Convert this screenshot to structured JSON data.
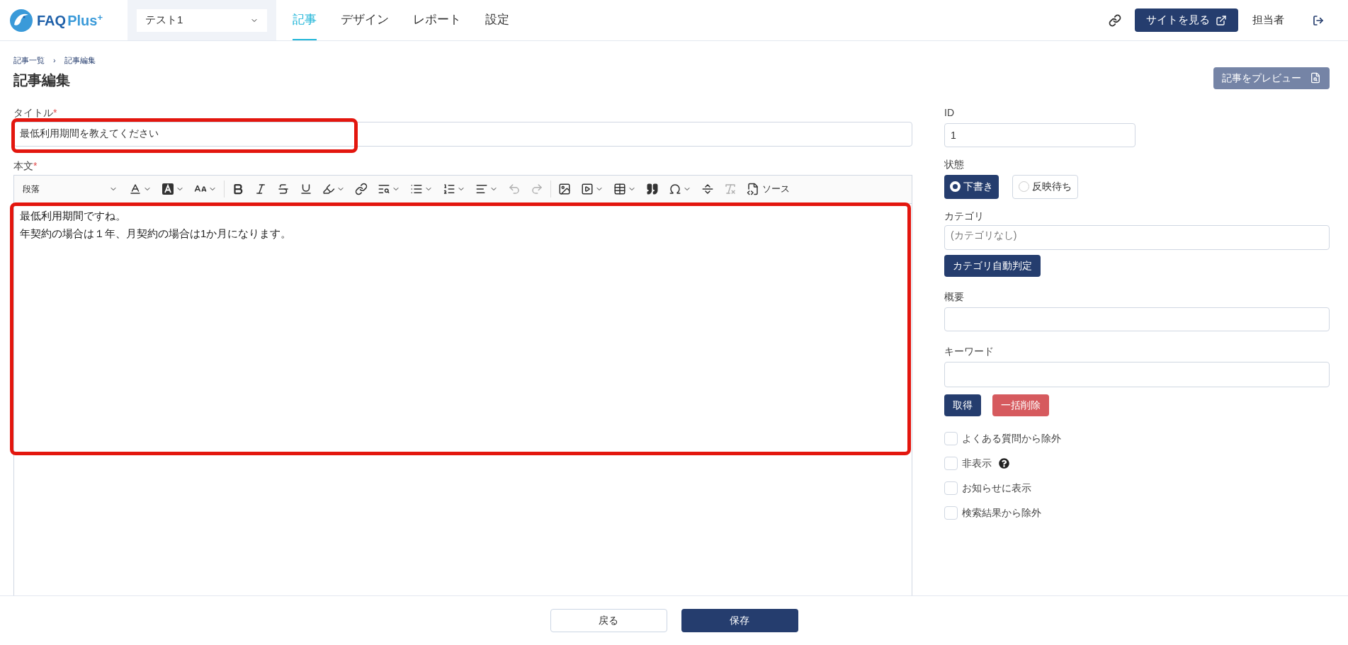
{
  "header": {
    "logo": {
      "part_1": "FAQ",
      "part_2": "Plus",
      "mark": "+"
    },
    "site_select": {
      "value": "テスト1"
    },
    "nav": [
      {
        "label": "記事",
        "selected": true
      },
      {
        "label": "デザイン",
        "selected": false
      },
      {
        "label": "レポート",
        "selected": false
      },
      {
        "label": "設定",
        "selected": false
      }
    ],
    "view_site_button": "サイトを見る",
    "user": "担当者"
  },
  "breadcrumb": [
    "記事一覧",
    "記事編集"
  ],
  "breadcrumb_separator": "›",
  "page_title": "記事編集",
  "preview_button": "記事をプレビュー",
  "title_field": {
    "label": "タイトル",
    "required": "*",
    "value": "最低利用期間を教えてください"
  },
  "body_field": {
    "label": "本文",
    "required": "*",
    "toolbar": {
      "paragraph_style": "段落",
      "source_button": "ソース",
      "undo": {
        "disabled": true
      },
      "redo": {
        "disabled": true
      },
      "remove_format": {
        "disabled": true
      }
    },
    "content": [
      "最低利用期間ですね。",
      "年契約の場合は１年、月契約の場合は1か月になります。"
    ]
  },
  "side": {
    "id": {
      "label": "ID",
      "value": "1"
    },
    "status": {
      "label": "状態",
      "options": [
        {
          "label": "下書き",
          "selected": true
        },
        {
          "label": "反映待ち",
          "selected": false
        }
      ]
    },
    "category": {
      "label": "カテゴリ",
      "placeholder": "(カテゴリなし)",
      "auto_button": "カテゴリ自動判定"
    },
    "summary": {
      "label": "概要"
    },
    "keywords": {
      "label": "キーワード",
      "fetch_button": "取得",
      "clear_button": "一括削除"
    },
    "options": [
      {
        "label": "よくある質問から除外",
        "checked": false,
        "help": false
      },
      {
        "label": "非表示",
        "checked": false,
        "help": true
      },
      {
        "label": "お知らせに表示",
        "checked": false,
        "help": false
      },
      {
        "label": "検索結果から除外",
        "checked": false,
        "help": false
      }
    ]
  },
  "footer": {
    "back_button": "戻る",
    "save_button": "保存"
  }
}
